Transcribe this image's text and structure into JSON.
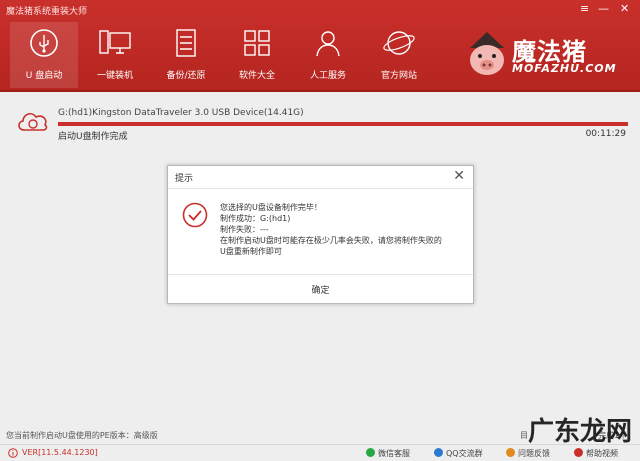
{
  "window": {
    "title": "魔法猪系统重装大师",
    "menu_icon": "≡",
    "minimize_icon": "—",
    "close_icon": "✕"
  },
  "nav": [
    {
      "label": "U 盘启动",
      "icon": "usb-icon",
      "active": true
    },
    {
      "label": "一键装机",
      "icon": "monitor-icon"
    },
    {
      "label": "备份/还原",
      "icon": "backup-icon"
    },
    {
      "label": "软件大全",
      "icon": "apps-grid-icon"
    },
    {
      "label": "人工服务",
      "icon": "person-icon"
    },
    {
      "label": "官方网站",
      "icon": "globe-icon"
    }
  ],
  "brand": {
    "cn": "魔法猪",
    "en": "MOFAZHU.COM"
  },
  "device": {
    "name": "G:(hd1)Kingston DataTraveler 3.0 USB Device(14.41G)",
    "status": "启动U盘制作完成",
    "elapsed": "00:11:29",
    "progress": 1.0
  },
  "dialog": {
    "title": "提示",
    "close_icon": "✕",
    "lines": [
      "您选择的U盘设备制作完毕！",
      "制作成功：G:(hd1)",
      "制作失败：---",
      "在制作启动U盘时可能存在极少几率会失败，请您将制作失败的",
      "U盘重新制作即可"
    ],
    "ok": "确定"
  },
  "footer": {
    "pe_info": "您当前制作启动U盘使用的PE版本：高级版",
    "side_partial": "目",
    "side_partial2": "完成1个",
    "version": "VER[11.5.44.1230]",
    "items": [
      "微信客服",
      "QQ交流群",
      "问题反馈",
      "帮助视频"
    ]
  },
  "watermark": "广东龙网",
  "colors": {
    "brand": "#c9302c",
    "accent_dark": "#a11d19"
  }
}
